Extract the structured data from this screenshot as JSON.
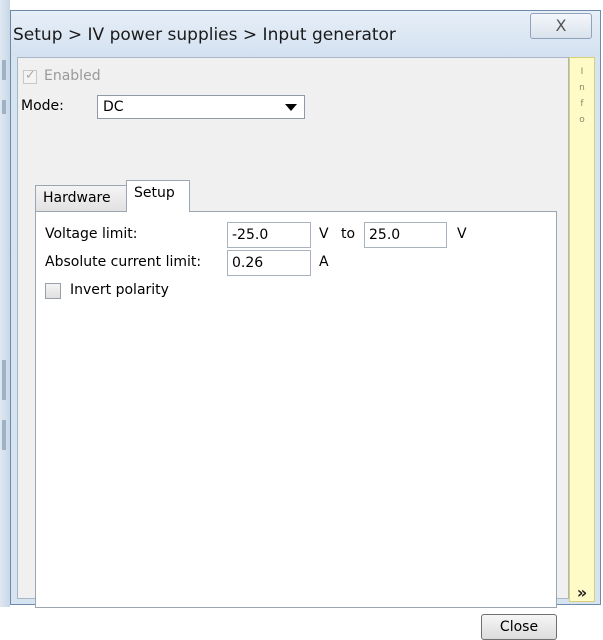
{
  "window": {
    "title": "Setup > IV power supplies > Input generator",
    "close_glyph": "X"
  },
  "general": {
    "enabled_label": "Enabled",
    "enabled_checked": true,
    "mode_label": "Mode:",
    "mode_value": "DC"
  },
  "tabs": [
    {
      "label": "Hardware",
      "active": false
    },
    {
      "label": "Setup",
      "active": true
    }
  ],
  "setup": {
    "voltage_label": "Voltage limit:",
    "voltage_min": "-25.0",
    "voltage_min_unit": "V",
    "to_label": "to",
    "voltage_max": "25.0",
    "voltage_max_unit": "V",
    "current_label": "Absolute current limit:",
    "current_value": "0.26",
    "current_unit": "A",
    "invert_label": "Invert polarity",
    "invert_checked": false
  },
  "info_panel": {
    "letters": [
      "I",
      "n",
      "f",
      "o"
    ],
    "expand_glyph": "»"
  },
  "footer": {
    "close_label": "Close"
  }
}
